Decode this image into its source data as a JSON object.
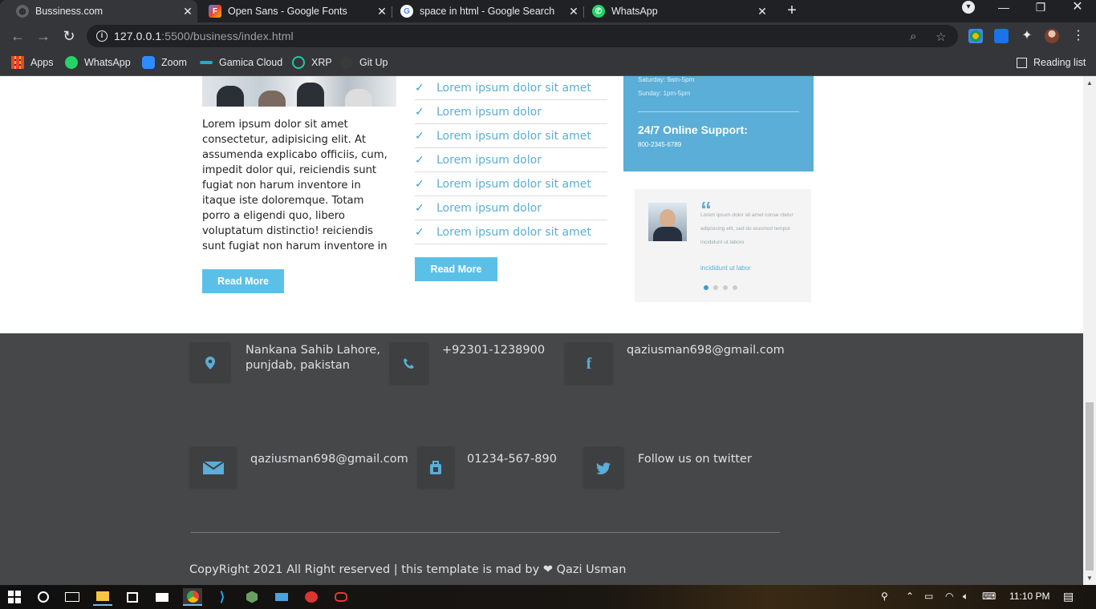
{
  "browser": {
    "tabs": [
      {
        "title": "Bussiness.com",
        "icon": "globe-icon",
        "active": true
      },
      {
        "title": "Open Sans - Google Fonts",
        "icon": "google-fonts-icon",
        "active": false
      },
      {
        "title": "space in html - Google Search",
        "icon": "google-icon",
        "active": false
      },
      {
        "title": "WhatsApp",
        "icon": "whatsapp-icon",
        "active": false
      }
    ],
    "url_host": "127.0.0.1",
    "url_rest": ":5500/business/index.html",
    "bookmarks": [
      {
        "label": "Apps",
        "icon": "apps-grid-icon"
      },
      {
        "label": "WhatsApp",
        "icon": "whatsapp-icon"
      },
      {
        "label": "Zoom",
        "icon": "zoom-icon"
      },
      {
        "label": "Gamica Cloud",
        "icon": "gamica-icon"
      },
      {
        "label": "XRP",
        "icon": "xrp-icon"
      },
      {
        "label": "Git Up",
        "icon": "github-icon"
      }
    ],
    "reading_list": "Reading list"
  },
  "content": {
    "paragraph": "Lorem ipsum dolor sit amet consectetur, adipisicing elit. At assumenda explicabo officiis, cum, impedit dolor qui, reiciendis sunt fugiat non harum inventore in itaque iste doloremque. Totam porro a eligendi quo, libero voluptatum distinctio! reiciendis sunt fugiat non harum inventore in",
    "read_more_1": "Read More",
    "checklist": [
      "Lorem ipsum dolor sit amet",
      "Lorem ipsum dolor",
      "Lorem ipsum dolor sit amet",
      "Lorem ipsum dolor",
      "Lorem ipsum dolor sit amet",
      "Lorem ipsum dolor",
      "Lorem ipsum dolor sit amet"
    ],
    "read_more_2": "Read More",
    "sidebox": {
      "hours_line1": "Saturday: 9am-5pm",
      "hours_line2": "Sunday: 1pm-5pm",
      "support_title": "24/7 Online Support:",
      "support_phone": "800-2345-6789"
    },
    "testimonial": {
      "text": "Lorem ipsum dolor sit amet conse ctetur adipisicing elit, sed do eiusmod tempor incididunt ut labore",
      "author": "incididunt ut labor",
      "slides": 4,
      "active_slide": 1
    }
  },
  "footer": {
    "address": "Nankana Sahib Lahore, punjdab, pakistan",
    "phone": "+92301-1238900",
    "facebook": "qaziusman698@gmail.com",
    "email": "qaziusman698@gmail.com",
    "mobile": "01234-567-890",
    "twitter": "Follow us on twitter",
    "copyright": "CopyRight 2021 All Right reserved | this template is mad by ❤ Qazi Usman"
  },
  "taskbar": {
    "time": "11:10 PM"
  },
  "colors": {
    "accent": "#5bc0e8",
    "footer_bg": "#464749",
    "chrome_dark": "#202124"
  }
}
